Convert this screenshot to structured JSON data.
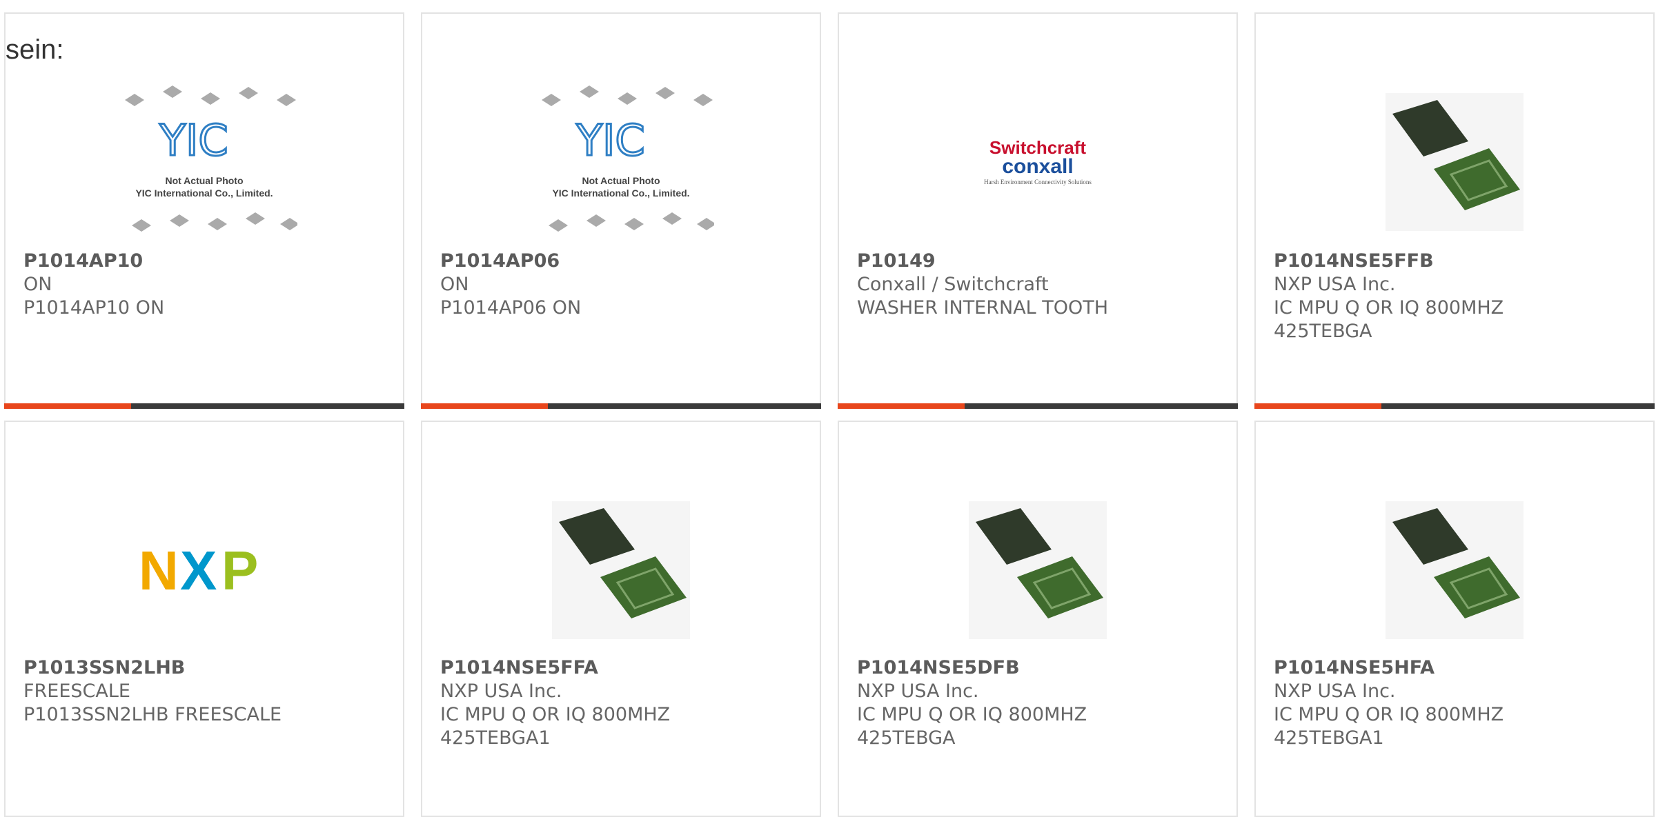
{
  "page": {
    "fragment_text": "sein:"
  },
  "colors": {
    "accent": "#e8461c",
    "bar_dark": "#3a3a3a",
    "border": "#e3e3e3"
  },
  "products": [
    {
      "pn": "P1014AP10",
      "manufacturer": "ON",
      "description": "P1014AP10 ON",
      "image": "yic-placeholder-image",
      "image_text": "Not Actual Photo YIC International Co., Limited."
    },
    {
      "pn": "P1014AP06",
      "manufacturer": "ON",
      "description": "P1014AP06 ON",
      "image": "yic-placeholder-image",
      "image_text": "Not Actual Photo YIC International Co., Limited."
    },
    {
      "pn": "P10149",
      "manufacturer": "Conxall / Switchcraft",
      "description": "WASHER INTERNAL TOOTH",
      "image": "switchcraft-conxall-logo",
      "image_text": "Switchcraft conxall Harsh Environment Connectivity Solutions"
    },
    {
      "pn": "P1014NSE5FFB",
      "manufacturer": "NXP USA Inc.",
      "description": "IC MPU Q OR IQ 800MHZ 425TEBGA",
      "image": "bga-chip-image"
    },
    {
      "pn": "P1013SSN2LHB",
      "manufacturer": "FREESCALE",
      "description": "P1013SSN2LHB FREESCALE",
      "image": "nxp-logo",
      "image_text": "NXP"
    },
    {
      "pn": "P1014NSE5FFA",
      "manufacturer": "NXP USA Inc.",
      "description": "IC MPU Q OR IQ 800MHZ 425TEBGA1",
      "image": "bga-chip-image"
    },
    {
      "pn": "P1014NSE5DFB",
      "manufacturer": "NXP USA Inc.",
      "description": "IC MPU Q OR IQ 800MHZ 425TEBGA",
      "image": "bga-chip-image"
    },
    {
      "pn": "P1014NSE5HFA",
      "manufacturer": "NXP USA Inc.",
      "description": "IC MPU Q OR IQ 800MHZ 425TEBGA1",
      "image": "bga-chip-image"
    }
  ]
}
